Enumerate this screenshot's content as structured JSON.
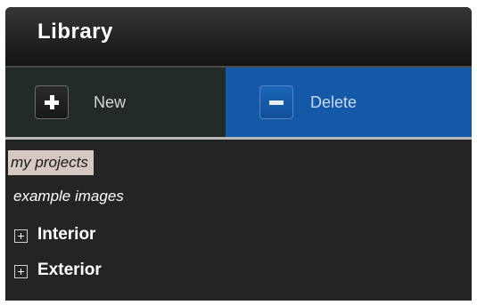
{
  "header": {
    "title": "Library"
  },
  "toolbar": {
    "new_label": "New",
    "new_icon": "plus-icon",
    "delete_label": "Delete",
    "delete_icon": "minus-icon",
    "delete_active_color": "#1359a7"
  },
  "tree": {
    "items": [
      {
        "label": "my projects",
        "selected": true
      },
      {
        "label": "example images",
        "selected": false
      }
    ],
    "groups": [
      {
        "label": "Interior",
        "expanded": false
      },
      {
        "label": "Exterior",
        "expanded": false
      }
    ]
  },
  "colors": {
    "panel_background": "#262626",
    "selection_background": "#d6c9c1"
  }
}
